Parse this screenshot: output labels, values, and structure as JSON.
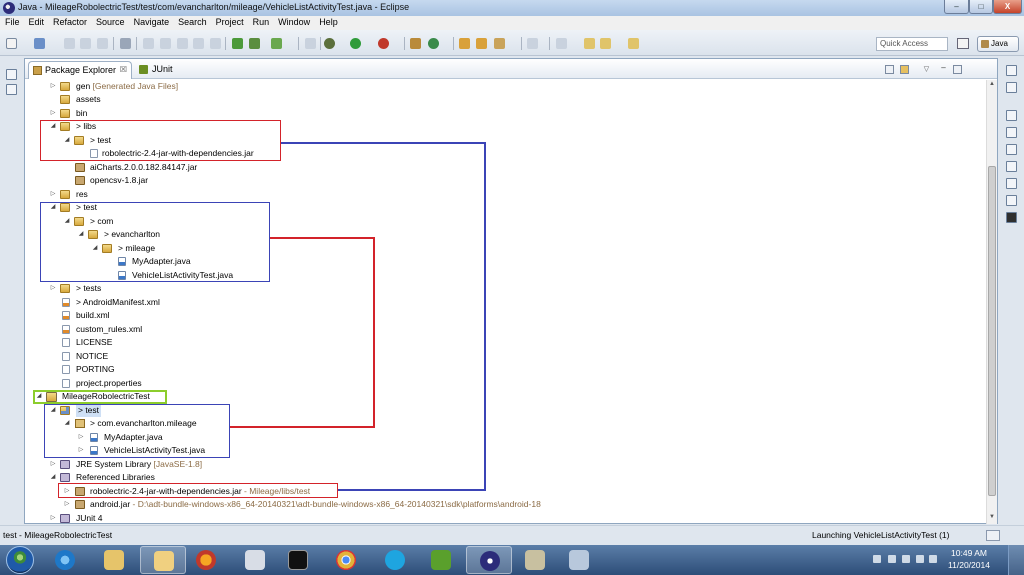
{
  "window": {
    "title": "Java - MileageRobolectricTest/test/com/evancharlton/mileage/VehicleListActivityTest.java - Eclipse",
    "controls": {
      "minimize": "–",
      "maximize": "□",
      "close": "X"
    }
  },
  "menubar": [
    "File",
    "Edit",
    "Refactor",
    "Source",
    "Navigate",
    "Search",
    "Project",
    "Run",
    "Window",
    "Help"
  ],
  "toolbar": {
    "quick_access_placeholder": "Quick Access",
    "perspective_label": "Java"
  },
  "view": {
    "explorer_tab_label": "Package Explorer",
    "explorer_tab_close": "☒",
    "junit_tab_label": "JUnit"
  },
  "tree": {
    "gen": "gen",
    "gen_dec": "[Generated Java Files]",
    "assets": "assets",
    "bin": "bin",
    "libs": "> libs",
    "libs_test": "> test",
    "robolectric_jar": "robolectric-2.4-jar-with-dependencies.jar",
    "aicharts_jar": "aiCharts.2.0.0.182.84147.jar",
    "opencsv_jar": "opencsv-1.8.jar",
    "res": "res",
    "test": "> test",
    "com": "> com",
    "evancharlton": "> evancharlton",
    "mileage": "> mileage",
    "myadapter": "MyAdapter.java",
    "vehiclelist": "VehicleListActivityTest.java",
    "tests": "> tests",
    "manifest": "> AndroidManifest.xml",
    "build_xml": "build.xml",
    "custom_rules": "custom_rules.xml",
    "license": "LICENSE",
    "notice": "NOTICE",
    "porting": "PORTING",
    "project_properties": "project.properties",
    "project": "MileageRobolectricTest",
    "p_test": "> test",
    "p_package": "> com.evancharlton.mileage",
    "p_myadapter": "MyAdapter.java",
    "p_vehiclelist": "VehicleListActivityTest.java",
    "jre": "JRE System Library",
    "jre_dec": "[JavaSE-1.8]",
    "ref_libs": "Referenced Libraries",
    "ref_robolectric": "robolectric-2.4-jar-with-dependencies.jar",
    "ref_robolectric_dec": "- Mileage/libs/test",
    "android_jar": "android.jar",
    "android_jar_dec": "- D:\\adt-bundle-windows-x86_64-20140321\\adt-bundle-windows-x86_64-20140321\\sdk\\platforms\\android-18",
    "junit4": "JUnit 4"
  },
  "status": {
    "left": "test - MileageRobolectricTest",
    "right": "Launching VehicleListActivityTest (1)"
  },
  "clock": {
    "time": "10:49 AM",
    "date": "11/20/2014"
  },
  "colors": {
    "highlight_red": "#d3232a",
    "highlight_blue": "#3b44b6",
    "highlight_green": "#8ccd2c"
  }
}
